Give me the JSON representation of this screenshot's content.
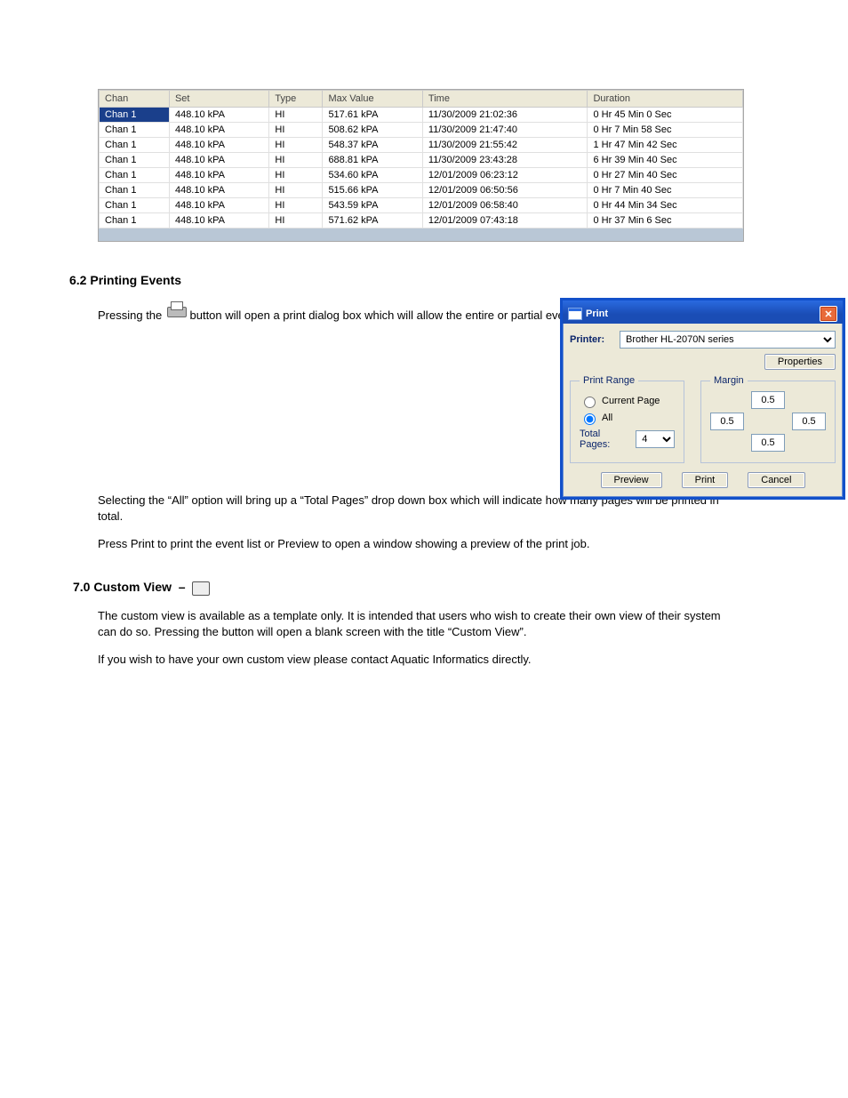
{
  "table": {
    "headers": [
      "Chan",
      "Set",
      "Type",
      "Max Value",
      "Time",
      "Duration"
    ],
    "rows": [
      {
        "chan": "Chan 1",
        "set": "448.10 kPA",
        "type": "HI",
        "max": "517.61 kPA",
        "time": "11/30/2009 21:02:36",
        "dur": "0 Hr 45 Min 0 Sec",
        "selected": true
      },
      {
        "chan": "Chan 1",
        "set": "448.10 kPA",
        "type": "HI",
        "max": "508.62 kPA",
        "time": "11/30/2009 21:47:40",
        "dur": "0 Hr 7 Min 58 Sec"
      },
      {
        "chan": "Chan 1",
        "set": "448.10 kPA",
        "type": "HI",
        "max": "548.37 kPA",
        "time": "11/30/2009 21:55:42",
        "dur": "1 Hr 47 Min 42 Sec"
      },
      {
        "chan": "Chan 1",
        "set": "448.10 kPA",
        "type": "HI",
        "max": "688.81 kPA",
        "time": "11/30/2009 23:43:28",
        "dur": "6 Hr 39 Min 40 Sec"
      },
      {
        "chan": "Chan 1",
        "set": "448.10 kPA",
        "type": "HI",
        "max": "534.60 kPA",
        "time": "12/01/2009 06:23:12",
        "dur": "0 Hr 27 Min 40 Sec"
      },
      {
        "chan": "Chan 1",
        "set": "448.10 kPA",
        "type": "HI",
        "max": "515.66 kPA",
        "time": "12/01/2009 06:50:56",
        "dur": "0 Hr 7 Min 40 Sec"
      },
      {
        "chan": "Chan 1",
        "set": "448.10 kPA",
        "type": "HI",
        "max": "543.59 kPA",
        "time": "12/01/2009 06:58:40",
        "dur": "0 Hr 44 Min 34 Sec"
      },
      {
        "chan": "Chan 1",
        "set": "448.10 kPA",
        "type": "HI",
        "max": "571.62 kPA",
        "time": "12/01/2009 07:43:18",
        "dur": "0 Hr 37 Min 6 Sec"
      }
    ]
  },
  "section_printing": {
    "heading": "6.2 Printing Events",
    "lines": [
      "Pressing the         button will open a print dialog box which will allow the entire or partial event list to be printed.",
      "Selecting the “All” option will bring up a “Total Pages” drop down box which will indicate how many pages will be printed in total.",
      "Press Print to print the event list or Preview to open a window showing a preview of the print job."
    ]
  },
  "print_dialog": {
    "title": "Print",
    "printer_label": "Printer:",
    "printer_value": "Brother HL-2070N series",
    "properties": "Properties",
    "range_legend": "Print Range",
    "range_current": "Current Page",
    "range_all": "All",
    "total_pages_label": "Total Pages:",
    "total_pages_value": "4",
    "margin_legend": "Margin",
    "margin_top": "0.5",
    "margin_left": "0.5",
    "margin_right": "0.5",
    "margin_bottom": "0.5",
    "btn_preview": "Preview",
    "btn_print": "Print",
    "btn_cancel": "Cancel"
  },
  "section_custom": {
    "heading": "7.0 Custom View",
    "icon_hint": "custom-view icon",
    "lines": [
      "The custom view is available as a template only. It is intended that users who wish to create their own view of their system can do so. Pressing the button will open a blank screen with the title “Custom View”.",
      "If you wish to have your own custom view please contact Aquatic Informatics directly."
    ]
  }
}
